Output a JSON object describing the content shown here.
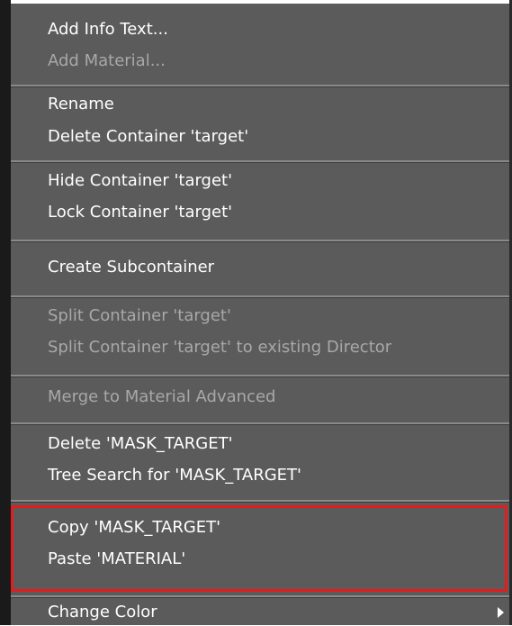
{
  "menu": {
    "add_info_text": "Add Info Text...",
    "add_material": "Add Material...",
    "rename": "Rename",
    "delete_container": "Delete Container 'target'",
    "hide_container": "Hide Container 'target'",
    "lock_container": "Lock Container 'target'",
    "create_subcontainer": "Create Subcontainer",
    "split_container": "Split Container 'target'",
    "split_container_director": "Split Container 'target' to existing Director",
    "merge_material_advanced": "Merge to Material Advanced",
    "delete_mask_target": "Delete 'MASK_TARGET'",
    "tree_search": "Tree Search for 'MASK_TARGET'",
    "copy_mask_target": "Copy 'MASK_TARGET'",
    "paste_material": "Paste 'MATERIAL'",
    "change_color": "Change Color"
  },
  "colors": {
    "menu_background": "#5b5b5b",
    "text_enabled": "#ffffff",
    "text_disabled": "#a8a8a8",
    "highlight_border": "#e01e1e"
  },
  "icons": {
    "submenu_arrow": "submenu-arrow-icon"
  }
}
